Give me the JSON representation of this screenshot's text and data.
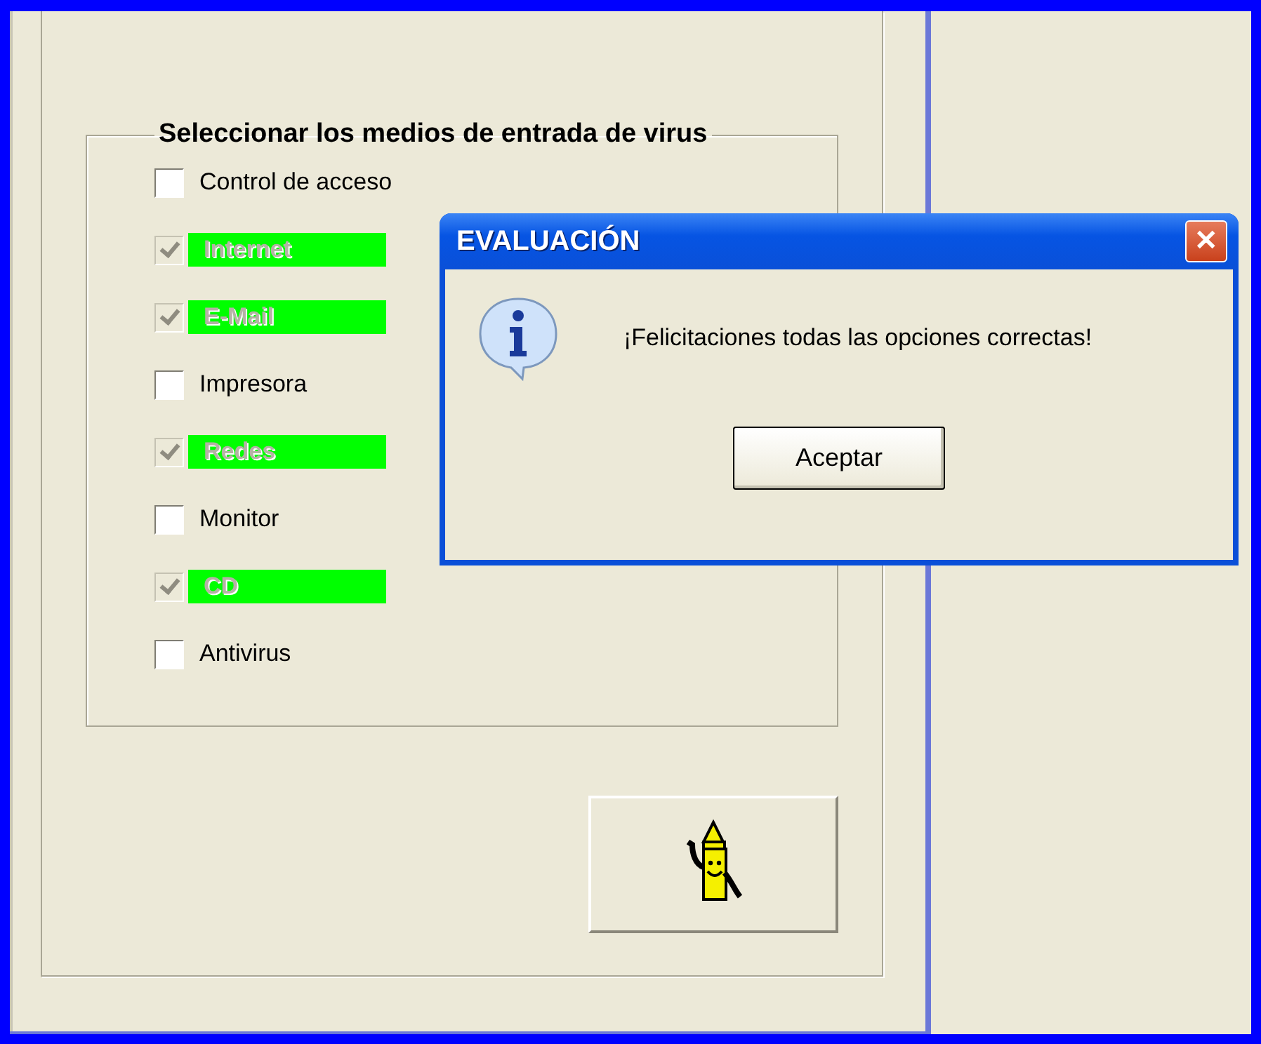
{
  "group": {
    "title": "Seleccionar los medios de entrada de virus",
    "options": [
      {
        "label": "Control de acceso",
        "checked": false,
        "disabled": false,
        "highlighted": false
      },
      {
        "label": "Internet",
        "checked": true,
        "disabled": true,
        "highlighted": true
      },
      {
        "label": "E-Mail",
        "checked": true,
        "disabled": true,
        "highlighted": true
      },
      {
        "label": "Impresora",
        "checked": false,
        "disabled": false,
        "highlighted": false
      },
      {
        "label": "Redes",
        "checked": true,
        "disabled": true,
        "highlighted": true
      },
      {
        "label": "Monitor",
        "checked": false,
        "disabled": false,
        "highlighted": false
      },
      {
        "label": "CD",
        "checked": true,
        "disabled": true,
        "highlighted": true
      },
      {
        "label": "Antivirus",
        "checked": false,
        "disabled": false,
        "highlighted": false
      }
    ]
  },
  "dialog": {
    "title": "EVALUACIÓN",
    "close": "✕",
    "message": "¡Felicitaciones todas las opciones correctas!",
    "buttons": [
      "Aceptar"
    ]
  }
}
